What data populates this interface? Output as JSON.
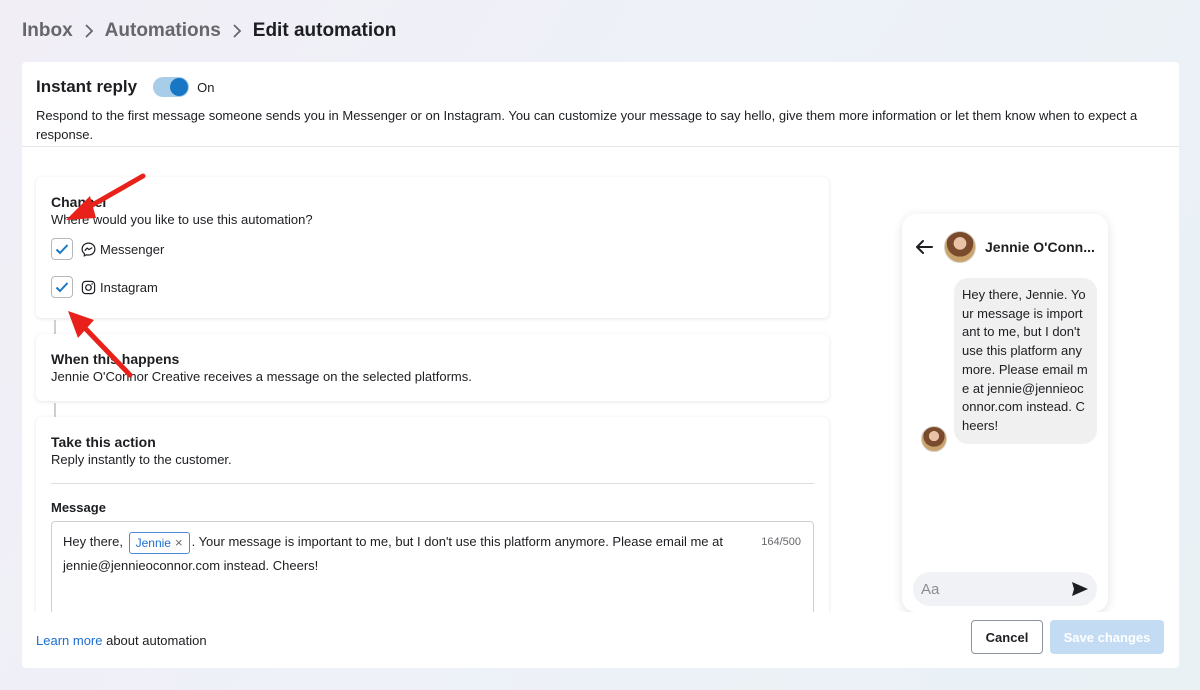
{
  "breadcrumb": {
    "items": [
      "Inbox",
      "Automations"
    ],
    "current": "Edit automation"
  },
  "header": {
    "title": "Instant reply",
    "toggle_state": "On",
    "description": "Respond to the first message someone sends you in Messenger or on Instagram. You can customize your message to say hello, give them more information or let them know when to expect a response."
  },
  "channel": {
    "title": "Channel",
    "subtitle": "Where would you like to use this automation?",
    "options": [
      {
        "label": "Messenger",
        "icon": "messenger-icon",
        "checked": true
      },
      {
        "label": "Instagram",
        "icon": "instagram-icon",
        "checked": true
      }
    ]
  },
  "trigger": {
    "title": "When this happens",
    "subtitle": "Jennie O'Connor Creative receives a message on the selected platforms."
  },
  "action": {
    "title": "Take this action",
    "subtitle": "Reply instantly to the customer.",
    "message_label": "Message",
    "message_prefix": "Hey there,",
    "chip_label": "Jennie",
    "message_suffix": ". Your message is important to me, but I don't use this platform anymore. Please email me at jennie@jennieoconnor.com instead. Cheers!",
    "char_count": "164/500"
  },
  "footer": {
    "learn_link": "Learn more",
    "learn_text": " about automation",
    "cancel_label": "Cancel",
    "save_label": "Save changes"
  },
  "preview": {
    "contact_name": "Jennie O'Conn...",
    "bubble_text": "Hey there, Jennie. Your message is important to me, but I don't use this platform anymore. Please email me at jennie@jennieoconnor.com instead. Cheers!",
    "composer_placeholder": "Aa"
  },
  "colors": {
    "accent": "#1877c5",
    "link": "#1b6fd0",
    "annotation_arrow": "#e8221b",
    "save_disabled": "#c3dcf3"
  }
}
